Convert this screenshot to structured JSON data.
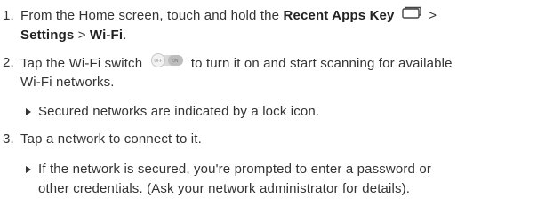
{
  "steps": [
    {
      "number": "1.",
      "line1_prefix": "From the Home screen, touch and hold the ",
      "line1_bold": "Recent Apps Key",
      "line1_suffix": " >",
      "line2_bold_a": "Settings",
      "line2_sep": " > ",
      "line2_bold_b": "Wi-Fi",
      "line2_end": ".",
      "icon": "recent-apps-key-icon"
    },
    {
      "number": "2.",
      "line1_prefix": "Tap the Wi-Fi switch",
      "line1_suffix": "to turn it on and start scanning for available",
      "line2": "Wi-Fi networks.",
      "icon": "wifi-switch-icon",
      "switch_off_label": "OFF",
      "switch_on_label": "ON",
      "bullet": "Secured networks are indicated by a lock icon."
    },
    {
      "number": "3.",
      "line1": "Tap a network to connect to it.",
      "bullet_line1": "If the network is secured, you're prompted to enter a password or",
      "bullet_line2": "other credentials. (Ask your network administrator for details)."
    }
  ]
}
